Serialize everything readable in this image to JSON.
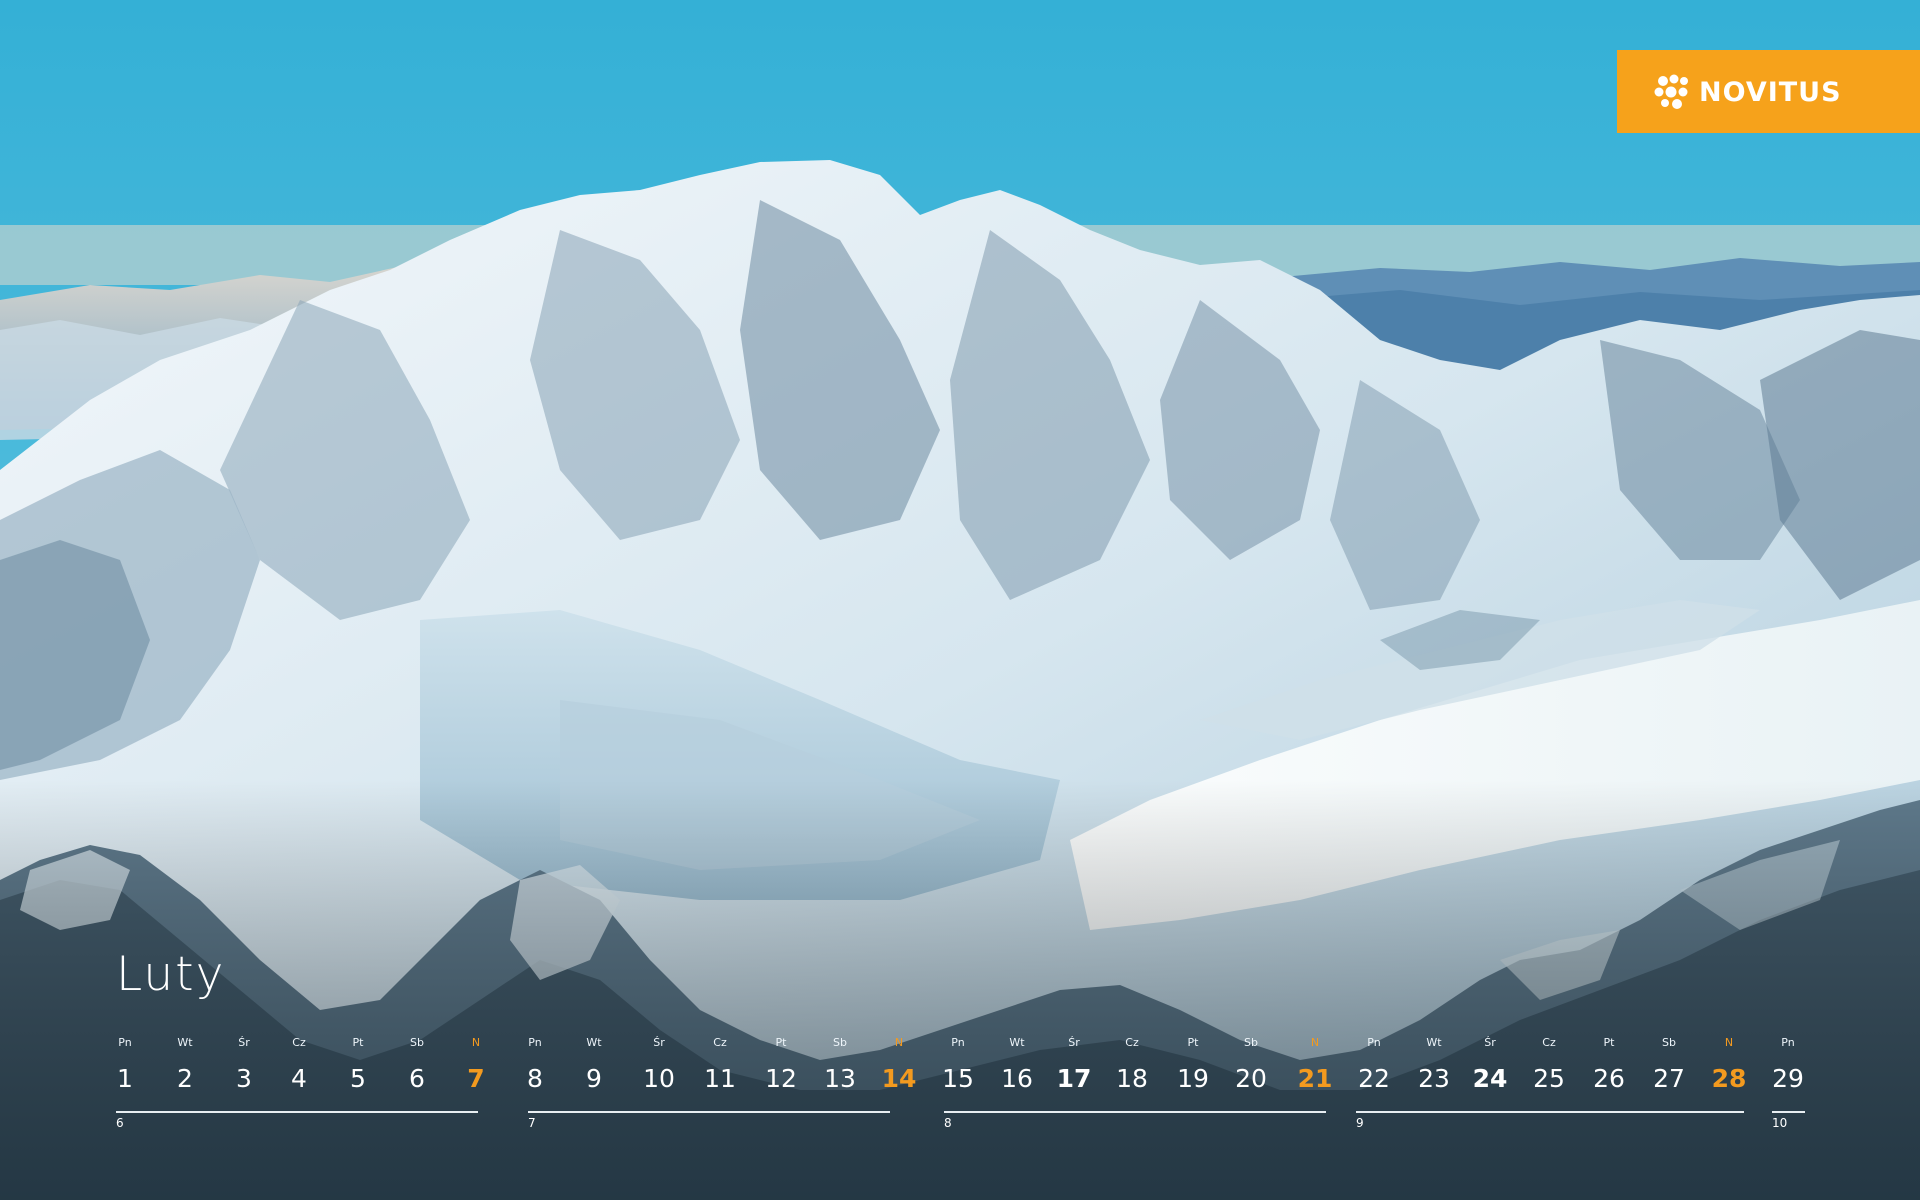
{
  "brand": {
    "name": "NOVITUS",
    "color": "#f6a21b"
  },
  "month": "Luty",
  "accent_color": "#f39a1f",
  "days": [
    {
      "dow": "Pn",
      "num": "1"
    },
    {
      "dow": "Wt",
      "num": "2"
    },
    {
      "dow": "Śr",
      "num": "3"
    },
    {
      "dow": "Cz",
      "num": "4"
    },
    {
      "dow": "Pt",
      "num": "5"
    },
    {
      "dow": "Sb",
      "num": "6"
    },
    {
      "dow": "N",
      "num": "7"
    },
    {
      "dow": "Pn",
      "num": "8"
    },
    {
      "dow": "Wt",
      "num": "9"
    },
    {
      "dow": "Śr",
      "num": "10"
    },
    {
      "dow": "Cz",
      "num": "11"
    },
    {
      "dow": "Pt",
      "num": "12"
    },
    {
      "dow": "Sb",
      "num": "13"
    },
    {
      "dow": "N",
      "num": "14"
    },
    {
      "dow": "Pn",
      "num": "15"
    },
    {
      "dow": "Wt",
      "num": "16"
    },
    {
      "dow": "Śr",
      "num": "17"
    },
    {
      "dow": "Cz",
      "num": "18"
    },
    {
      "dow": "Pt",
      "num": "19"
    },
    {
      "dow": "Sb",
      "num": "20"
    },
    {
      "dow": "N",
      "num": "21"
    },
    {
      "dow": "Pn",
      "num": "22"
    },
    {
      "dow": "Wt",
      "num": "23"
    },
    {
      "dow": "Śr",
      "num": "24"
    },
    {
      "dow": "Cz",
      "num": "25"
    },
    {
      "dow": "Pt",
      "num": "26"
    },
    {
      "dow": "Sb",
      "num": "27"
    },
    {
      "dow": "N",
      "num": "28"
    },
    {
      "dow": "Pn",
      "num": "29"
    }
  ],
  "week_numbers": [
    "6",
    "7",
    "8",
    "9",
    "10"
  ]
}
